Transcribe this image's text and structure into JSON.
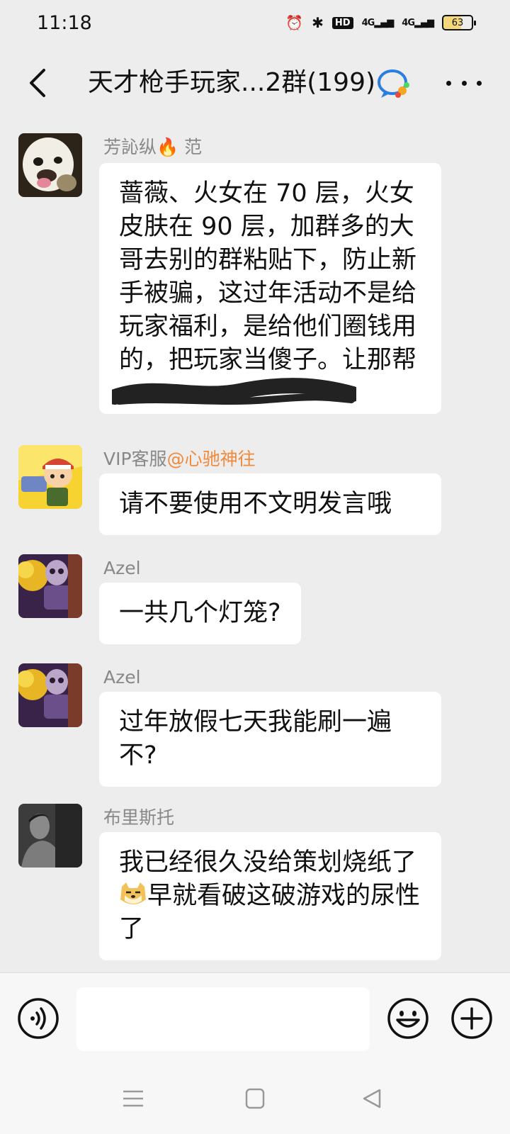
{
  "status_bar": {
    "time": "11:18",
    "hd_label": "HD",
    "signal_1": "4G",
    "signal_2": "4G",
    "battery": "63"
  },
  "header": {
    "title": "天才枪手玩家...2群(199)",
    "icons": {
      "back": "chevron-left-icon",
      "group": "group-chat-icon",
      "more": "more-icon"
    }
  },
  "messages": [
    {
      "sender": "芳訫纵🔥 范",
      "text": "蔷薇、火女在 70 层，火女皮肤在 90 层，加群多的大哥去别的群粘贴下，防止新手被骗，这过年活动不是给玩家福利，是给他们圈钱用的，把玩家当傻子。让那帮"
    },
    {
      "sender": "VIP客服",
      "sender_mention": "@心驰神往",
      "text": "请不要使用不文明发言哦"
    },
    {
      "sender": "Azel",
      "text": "一共几个灯笼?"
    },
    {
      "sender": "Azel",
      "text": "过年放假七天我能刷一遍不?"
    },
    {
      "sender": "布里斯托",
      "text_line1": "我已经很久没给策划烧纸了",
      "text_line2": "早就看破这破游戏的尿性了"
    }
  ],
  "input_bar": {
    "placeholder": "",
    "icons": [
      "voice-icon",
      "emoji-icon",
      "plus-icon"
    ]
  },
  "system_nav": {
    "icons": [
      "menu-icon",
      "home-icon",
      "back-triangle-icon"
    ]
  },
  "colors": {
    "background": "#ededed",
    "bubble": "#ffffff",
    "mention": "#f08a3c",
    "sender": "#888888"
  }
}
